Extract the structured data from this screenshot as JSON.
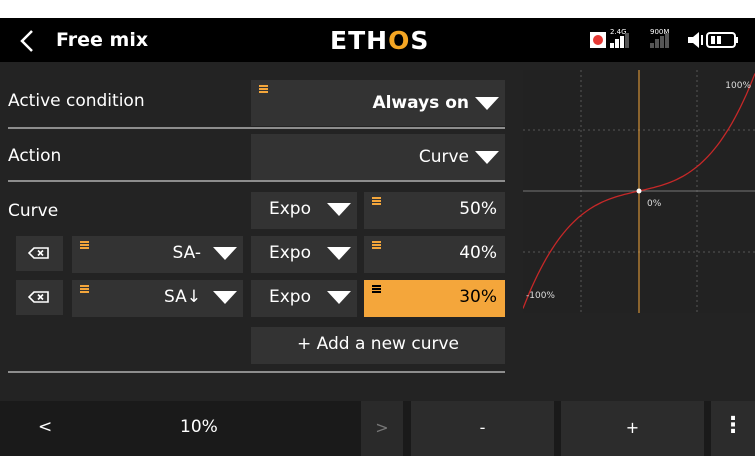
{
  "header": {
    "title": "Free mix",
    "logo": [
      "ETH",
      "O",
      "S"
    ],
    "band1": "2.4G",
    "band2": "900M"
  },
  "rows": {
    "active_condition": {
      "label": "Active condition",
      "value": "Always on"
    },
    "action": {
      "label": "Action",
      "value": "Curve"
    },
    "curve": {
      "label": "Curve",
      "type": "Expo",
      "value": "50%"
    },
    "curve_row2": {
      "source": "SA-",
      "type": "Expo",
      "value": "40%"
    },
    "curve_row3": {
      "source": "SA↓",
      "type": "Expo",
      "value": "30%"
    },
    "add_curve": "+ Add a new curve"
  },
  "graph": {
    "top_label": "100%",
    "center_label": "0%",
    "bottom_label": "-100%",
    "curve_color": "#c62828",
    "axis_color": "#f4a63b"
  },
  "bottom_bar": {
    "prev": "<",
    "value": "10%",
    "next": ">",
    "minus": "-",
    "plus": "+",
    "more": "⋮"
  },
  "colors": {
    "accent": "#f4a63b",
    "background": "#232323",
    "header": "#000000"
  }
}
